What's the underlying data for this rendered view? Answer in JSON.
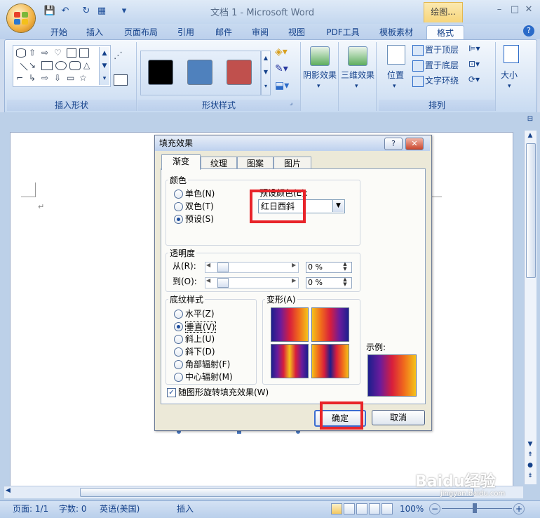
{
  "window": {
    "title": "文档 1 - Microsoft Word",
    "context_tab": "绘图...",
    "controls": {
      "minimize": "–",
      "maximize": "□",
      "close": "✕"
    }
  },
  "quick_access": {
    "save": "💾",
    "undo": "↶",
    "redo": "↻",
    "more": "▾"
  },
  "tabs": [
    "开始",
    "插入",
    "页面布局",
    "引用",
    "邮件",
    "审阅",
    "视图",
    "PDF工具",
    "模板素材",
    "格式"
  ],
  "active_tab": "格式",
  "ribbon": {
    "groups": {
      "insert_shapes": "插入形状",
      "shape_styles": "形状样式",
      "arrange": "排列"
    },
    "buttons": {
      "shadow_effects": "阴影效果",
      "3d_effects": "三维效果",
      "position": "位置",
      "bring_to_front": "置于顶层",
      "send_to_back": "置于底层",
      "text_wrapping": "文字环绕",
      "size": "大小"
    },
    "swatch_colors": [
      "#000000",
      "#4f81bd",
      "#c0504d"
    ]
  },
  "status_bar": {
    "page": "页面: 1/1",
    "words": "字数: 0",
    "language": "英语(美国)",
    "mode": "插入",
    "zoom": "100%",
    "zoom_minus": "−",
    "zoom_plus": "+"
  },
  "dialog": {
    "title": "填充效果",
    "help": "?",
    "close": "✕",
    "tabs": [
      "渐变",
      "纹理",
      "图案",
      "图片"
    ],
    "active_tab": "渐变",
    "colors": {
      "legend": "颜色",
      "options": [
        "单色(N)",
        "双色(T)",
        "预设(S)"
      ],
      "selected": "预设(S)",
      "preset_label": "预设颜色(E):",
      "preset_value": "红日西斜"
    },
    "transparency": {
      "legend": "透明度",
      "from_label": "从(R):",
      "to_label": "到(O):",
      "from_value": "0 %",
      "to_value": "0 %"
    },
    "shading": {
      "legend": "底纹样式",
      "options": [
        "水平(Z)",
        "垂直(V)",
        "斜上(U)",
        "斜下(D)",
        "角部辐射(F)",
        "中心辐射(M)"
      ],
      "selected": "垂直(V)"
    },
    "variants_label": "变形(A)",
    "sample_label": "示例:",
    "rotate_with_shape": "随图形旋转填充效果(W)",
    "rotate_checked": true,
    "ok": "确定",
    "cancel": "取消",
    "gradient_colors": [
      "#1c1e8c",
      "#6a1c9c",
      "#d81e3c",
      "#f06a1c",
      "#f4c21a"
    ]
  },
  "watermark": {
    "logo": "Baidu经验",
    "url": "jingyan.baidu.com"
  }
}
